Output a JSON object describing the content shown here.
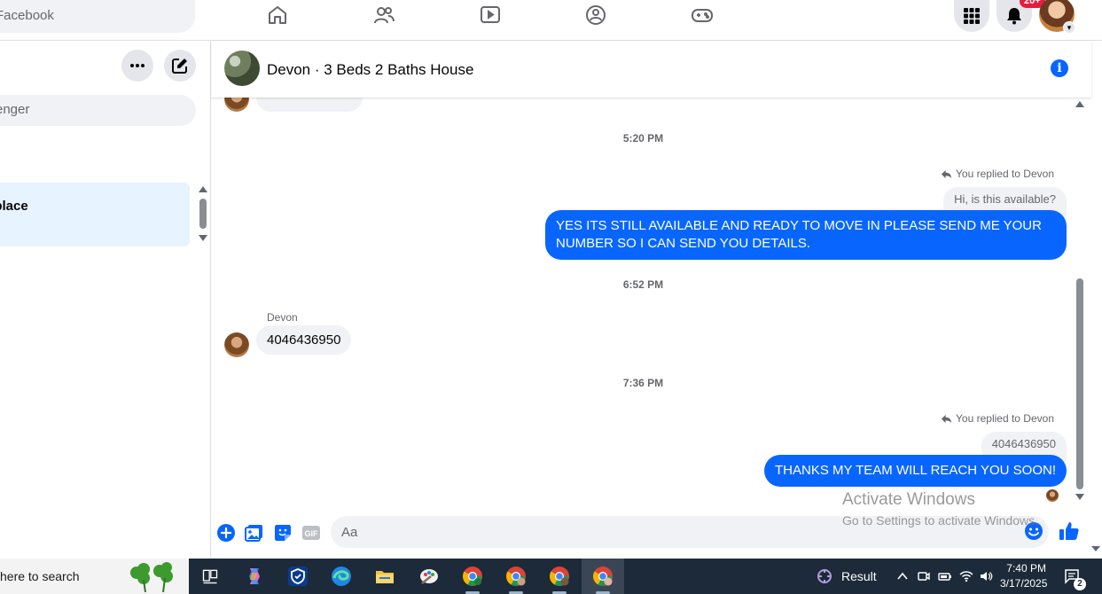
{
  "topbar": {
    "search_placeholder": "rch Facebook",
    "nav_icons": [
      "home-icon",
      "friends-icon",
      "watch-icon",
      "groups-icon",
      "gaming-icon"
    ],
    "notifications_badge": "20+"
  },
  "sidebar": {
    "search_placeholder": "ssenger",
    "active_item_label": "etplace"
  },
  "chat": {
    "title": "Devon · 3 Beds 2 Baths House",
    "messages": {
      "ts1": "5:20 PM",
      "reply1_meta": "You replied to Devon",
      "reply1_quote": "Hi, is this available?",
      "out1": "YES ITS STILL AVAILABLE AND READY TO MOVE IN PLEASE SEND ME YOUR NUMBER SO I CAN SEND YOU DETAILS.",
      "ts2": "6:52 PM",
      "sender": "Devon",
      "in1": "4046436950",
      "ts3": "7:36 PM",
      "reply2_meta": "You replied to Devon",
      "reply2_quote": "4046436950",
      "out2": "THANKS MY TEAM WILL REACH YOU SOON!"
    },
    "composer_placeholder": "Aa",
    "gif_label": "GIF"
  },
  "watermark": {
    "line1": "Activate Windows",
    "line2": "Go to Settings to activate Windows."
  },
  "taskbar": {
    "search_text": "here to search",
    "result_label": "Result",
    "time": "7:40 PM",
    "date": "3/17/2025",
    "notification_count": "2"
  },
  "colors": {
    "brand_blue": "#0866ff",
    "bubble_gray": "#f0f2f5",
    "badge_red": "#e41e3f",
    "taskbar": "#1c2a3a"
  }
}
